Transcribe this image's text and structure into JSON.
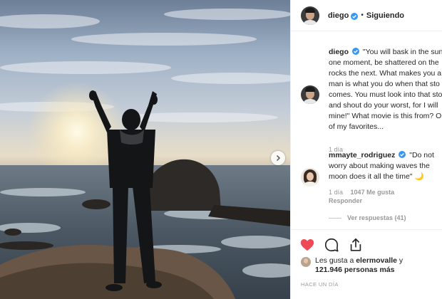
{
  "post": {
    "username": "diego",
    "separator": "•",
    "follow_status": "Siguiendo"
  },
  "caption": {
    "username": "diego",
    "lines": [
      "\"You will bask in the sunli",
      "one moment, be shattered on the",
      "rocks the next. What makes you a",
      "man is what you do when that sto",
      "comes. You must look into that sto",
      "and shout do your worst, for I will",
      "mine!\" What movie is this from? O",
      "of my favorites..."
    ],
    "time": "1 día"
  },
  "comment": {
    "username": "mmayte_rodriguez",
    "lines": [
      "\"Do not",
      "worry about making waves the",
      "moon does it all the time\" 🌙"
    ],
    "time": "1 día",
    "likes": "1047 Me gusta",
    "reply": "Responder",
    "view_replies": "Ver respuestas (41)"
  },
  "likes": {
    "line1_prefix": "Les gusta a ",
    "line1_user": "elermovalle",
    "line1_suffix": " y",
    "line2_count": "121.946",
    "line2_suffix": " personas más"
  },
  "timestamp": "HACE UN DÍA",
  "icons": {
    "like": "heart-icon",
    "comment": "comment-icon",
    "share": "share-icon",
    "verified": "verified-badge-icon",
    "next": "chevron-right-icon"
  },
  "colors": {
    "like_red": "#ed4956",
    "verified_blue": "#3897f0",
    "meta_gray": "#999999"
  }
}
